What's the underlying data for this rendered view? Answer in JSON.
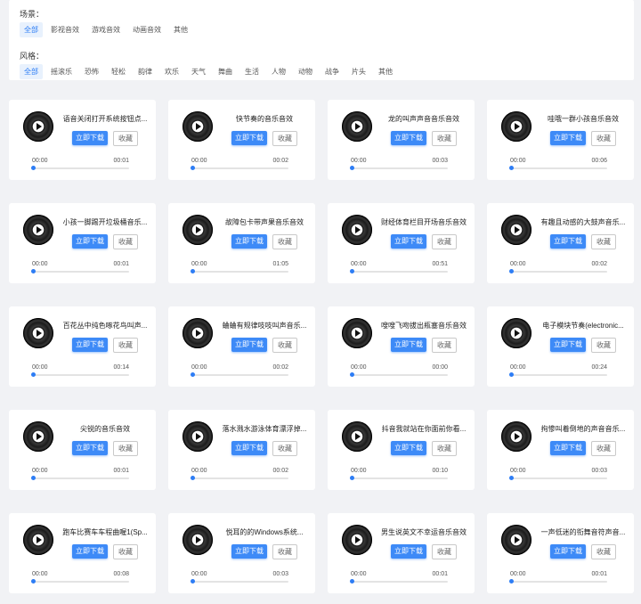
{
  "filters": {
    "scene_label": "场景：",
    "scene_options": [
      "全部",
      "影视音效",
      "游戏音效",
      "动画音效",
      "其他"
    ],
    "style_label": "风格：",
    "style_options": [
      "全部",
      "摇滚乐",
      "恐怖",
      "轻松",
      "韵律",
      "欢乐",
      "天气",
      "舞曲",
      "生活",
      "人物",
      "动物",
      "战争",
      "片头",
      "其他"
    ]
  },
  "card_labels": {
    "download": "立即下载",
    "favorite": "收藏"
  },
  "sounds": [
    {
      "title": "语音关闭打开系统按钮点...",
      "start": "00:00",
      "end": "00:01"
    },
    {
      "title": "快节奏的音乐音效",
      "start": "00:00",
      "end": "00:02"
    },
    {
      "title": "龙的叫声声音音乐音效",
      "start": "00:00",
      "end": "00:03"
    },
    {
      "title": "哇哦一群小孩音乐音效",
      "start": "00:00",
      "end": "00:06"
    },
    {
      "title": "小孩一脚踢开垃圾桶音乐...",
      "start": "00:00",
      "end": "00:01"
    },
    {
      "title": "故障包卡带声果音乐音效",
      "start": "00:00",
      "end": "01:05"
    },
    {
      "title": "财经体育栏目开场音乐音效",
      "start": "00:00",
      "end": "00:51"
    },
    {
      "title": "有趣且动感的大鼓声音乐...",
      "start": "00:00",
      "end": "00:02"
    },
    {
      "title": "百花丛中纯色啄花鸟叫声...",
      "start": "00:00",
      "end": "00:14"
    },
    {
      "title": "蛐蛐有规律吱吱叫声音乐...",
      "start": "00:00",
      "end": "00:02"
    },
    {
      "title": "嗖嗖飞吻拔出瓶塞音乐音效",
      "start": "00:00",
      "end": "00:00"
    },
    {
      "title": "电子模块节奏(electronic...",
      "start": "00:00",
      "end": "00:24"
    },
    {
      "title": "尖锐的音乐音效",
      "start": "00:00",
      "end": "00:01"
    },
    {
      "title": "落水溅水游泳体育漂浮掉...",
      "start": "00:00",
      "end": "00:02"
    },
    {
      "title": "抖音我就站在你面前你看...",
      "start": "00:00",
      "end": "00:10"
    },
    {
      "title": "拘惨叫着倒地的声音音乐...",
      "start": "00:00",
      "end": "00:03"
    },
    {
      "title": "跑车比赛车车程曲喔1(Sp...",
      "start": "00:00",
      "end": "00:08"
    },
    {
      "title": "悦耳的的Windows系统...",
      "start": "00:00",
      "end": "00:03"
    },
    {
      "title": "男生说英文不幸运音乐音效",
      "start": "00:00",
      "end": "00:01"
    },
    {
      "title": "一声低迷的衔舞音符声音...",
      "start": "00:00",
      "end": "00:01"
    }
  ]
}
